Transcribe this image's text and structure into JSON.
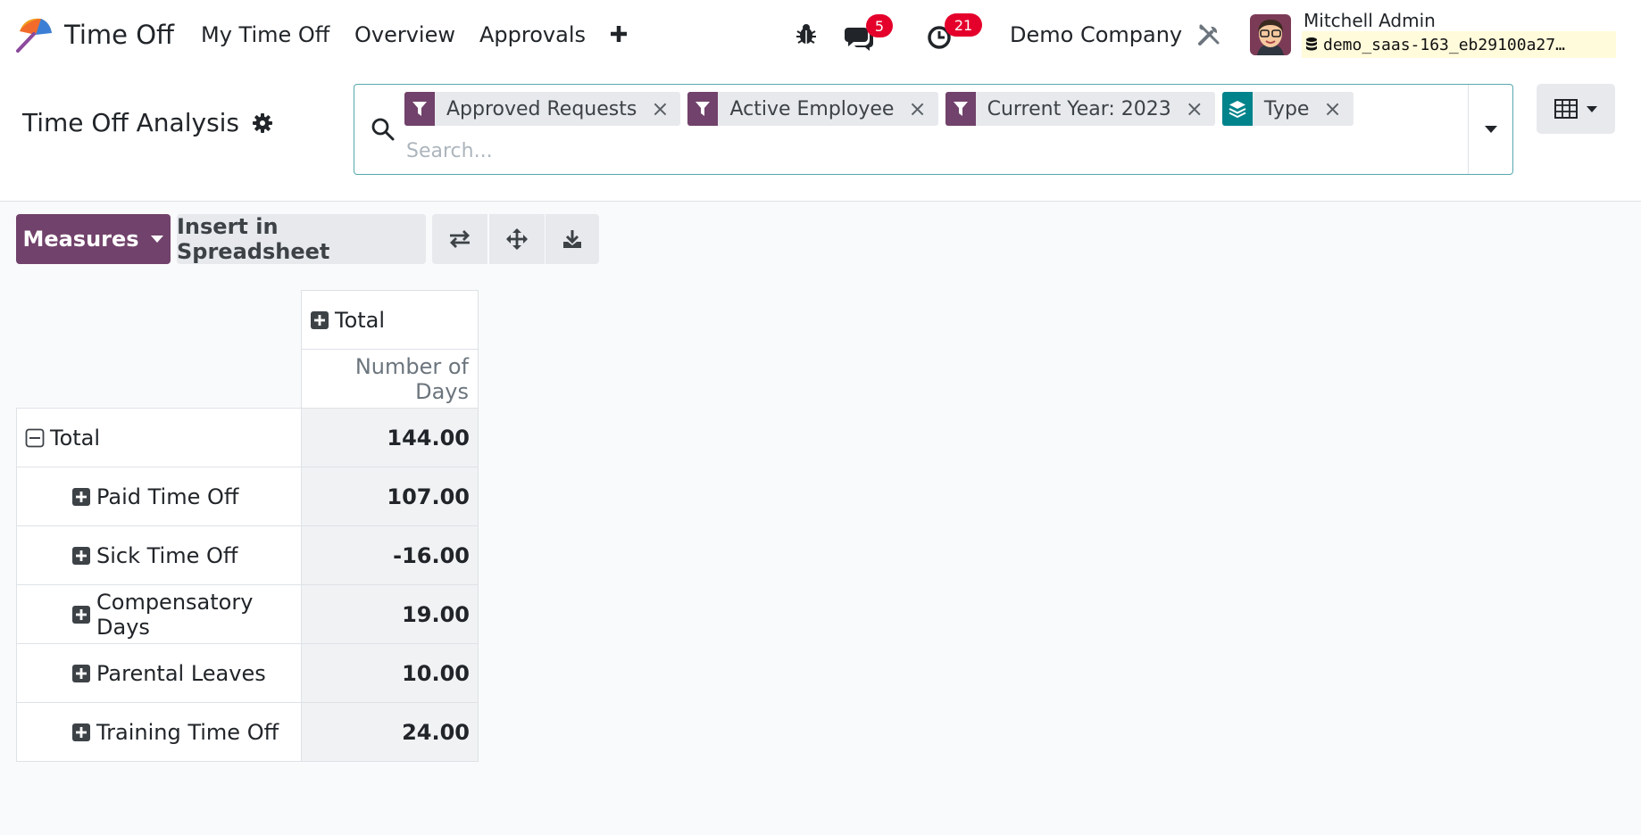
{
  "navbar": {
    "app_name": "Time Off",
    "menu": [
      "My Time Off",
      "Overview",
      "Approvals"
    ],
    "messages_count": "5",
    "activities_count": "21",
    "company": "Demo Company",
    "user_name": "Mitchell Admin",
    "database": "demo_saas-163_eb29100a27…"
  },
  "control_panel": {
    "title": "Time Off Analysis",
    "search_placeholder": "Search...",
    "facets": [
      {
        "label": "Approved Requests",
        "icon": "filter-icon",
        "color": "#71426b"
      },
      {
        "label": "Active Employee",
        "icon": "filter-icon",
        "color": "#71426b"
      },
      {
        "label": "Current Year: 2023",
        "icon": "filter-icon",
        "color": "#71426b"
      },
      {
        "label": "Type",
        "icon": "groupby-layers-icon",
        "color": "#00838b"
      }
    ]
  },
  "buttons": {
    "measures": "Measures",
    "insert": "Insert in Spreadsheet"
  },
  "pivot": {
    "col_header": "Total",
    "measure": "Number of Days",
    "total_label": "Total",
    "total_value": "144.00",
    "rows": [
      {
        "label": "Paid Time Off",
        "value": "107.00"
      },
      {
        "label": "Sick Time Off",
        "value": "-16.00"
      },
      {
        "label": "Compensatory Days",
        "value": "19.00"
      },
      {
        "label": "Parental Leaves",
        "value": "10.00"
      },
      {
        "label": "Training Time Off",
        "value": "24.00"
      }
    ]
  },
  "colors": {
    "primary": "#71426b",
    "groupby": "#00838b",
    "badge": "#e4002b",
    "focus": "#57a8ae"
  }
}
